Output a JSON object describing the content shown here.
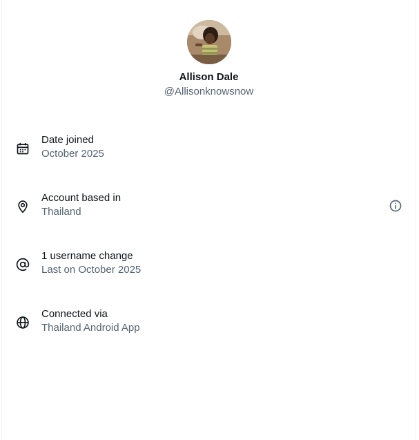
{
  "profile": {
    "display_name": "Allison Dale",
    "handle": "@Allisonknowsnow"
  },
  "details": [
    {
      "icon": "calendar-icon",
      "label": "Date joined",
      "value": "October 2025"
    },
    {
      "icon": "location-pin-icon",
      "label": "Account based in",
      "value": "Thailand"
    },
    {
      "icon": "at-sign-icon",
      "label": "1 username change",
      "value": "Last on October 2025"
    },
    {
      "icon": "globe-icon",
      "label": "Connected via",
      "value": "Thailand Android App"
    }
  ],
  "colors": {
    "primary_text": "#0f1419",
    "secondary_text": "#536471"
  }
}
